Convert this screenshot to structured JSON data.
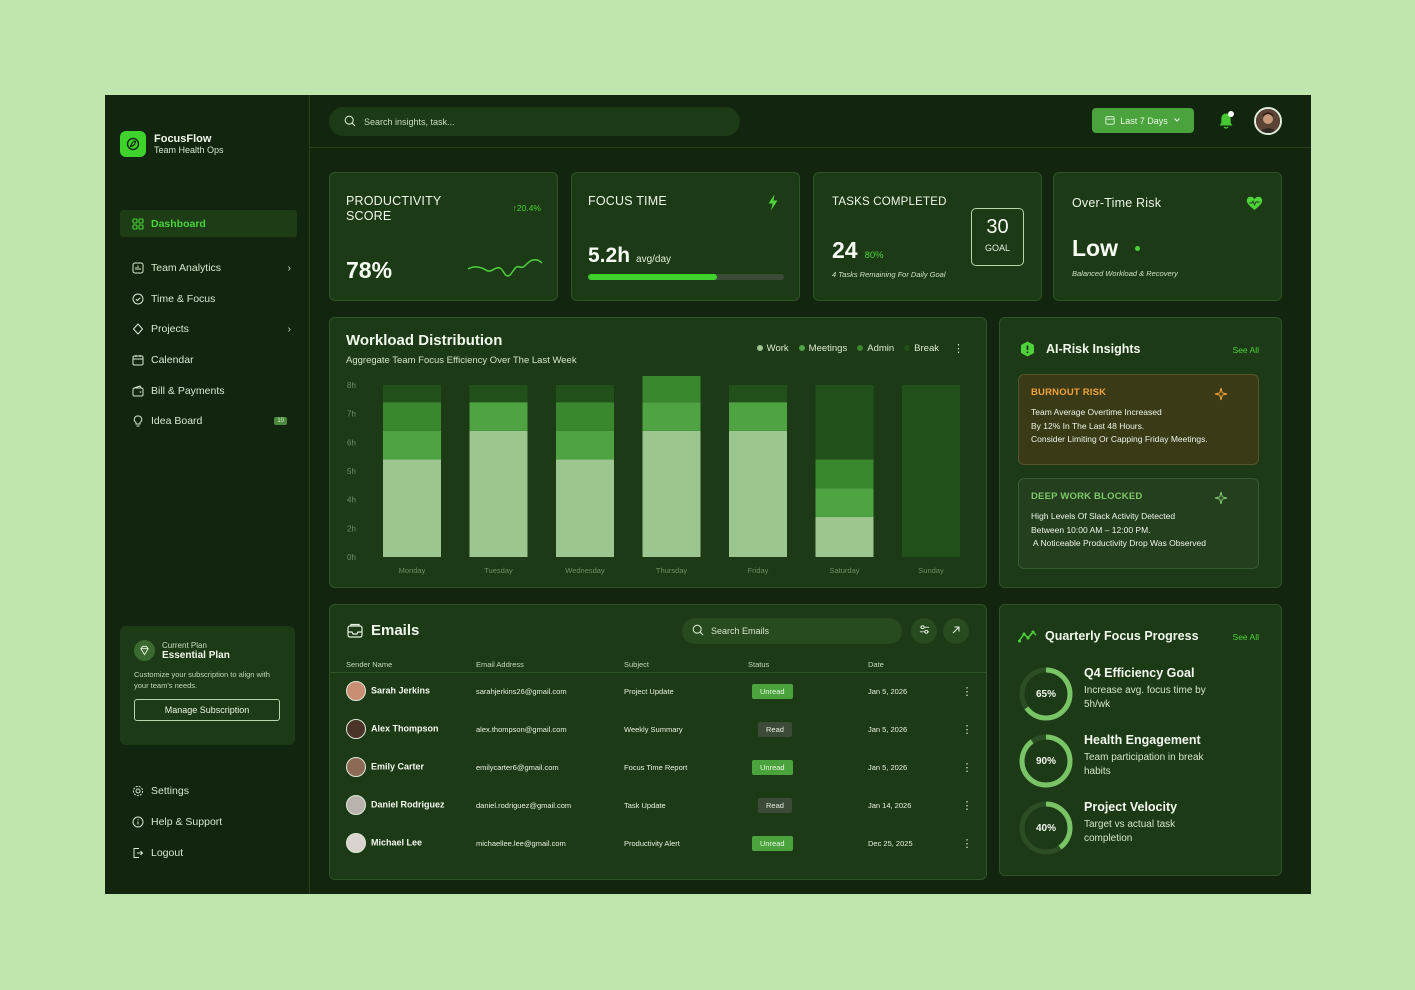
{
  "brand": {
    "name": "FocusFlow",
    "subtitle": "Team Health Ops"
  },
  "nav": [
    {
      "label": "Dashboard",
      "icon": "dashboard-icon",
      "active": true
    },
    {
      "label": "Team Analytics",
      "icon": "analytics-icon",
      "chevron": true
    },
    {
      "label": "Time & Focus",
      "icon": "clock-check-icon"
    },
    {
      "label": "Projects",
      "icon": "projects-icon",
      "chevron": true
    },
    {
      "label": "Calendar",
      "icon": "calendar-icon"
    },
    {
      "label": "Bill & Payments",
      "icon": "wallet-icon"
    },
    {
      "label": "Idea Board",
      "icon": "lightbulb-icon",
      "badge": "10"
    }
  ],
  "plan": {
    "label": "Current Plan",
    "name": "Essential Plan",
    "description": "Customize your subscription to align with your team's needs.",
    "button": "Manage Subscription"
  },
  "bottom_nav": [
    {
      "label": "Settings",
      "icon": "gear-icon"
    },
    {
      "label": "Help & Support",
      "icon": "info-icon"
    },
    {
      "label": "Logout",
      "icon": "logout-icon"
    }
  ],
  "search": {
    "placeholder": "Search insights, task..."
  },
  "date_range": "Last 7 Days",
  "kpis": {
    "productivity": {
      "title": "PRODUCTIVITY SCORE",
      "value": "78%",
      "change": "20.4%"
    },
    "focus": {
      "title": "FOCUS TIME",
      "value": "5.2h",
      "unit": "avg/day",
      "progress": 0.66
    },
    "tasks": {
      "title": "TASKS COMPLETED",
      "value": "24",
      "percent": "80%",
      "note": "4 Tasks Remaining For Daily Goal",
      "goal_value": "30",
      "goal_label": "GOAL"
    },
    "risk": {
      "title": "Over-Time Risk",
      "value": "Low",
      "note": "Balanced Workload & Recovery"
    }
  },
  "workload": {
    "title": "Workload Distribution",
    "subtitle": "Aggregate Team Focus Efficiency Over The Last Week",
    "legend": [
      {
        "name": "Work",
        "color": "#9cc590"
      },
      {
        "name": "Meetings",
        "color": "#4fa342"
      },
      {
        "name": "Admin",
        "color": "#3b8730"
      },
      {
        "name": "Break",
        "color": "#21501a"
      }
    ]
  },
  "chart_data": {
    "type": "bar",
    "stacked": true,
    "categories": [
      "Monday",
      "Tuesday",
      "Wednesday",
      "Thursday",
      "Friday",
      "Saturday",
      "Sunday"
    ],
    "y_ticks": [
      "0h",
      "2h",
      "4h",
      "5h",
      "6h",
      "7h",
      "8h"
    ],
    "series": [
      {
        "name": "Work",
        "color": "#9cc590",
        "values": [
          3.4,
          4.4,
          3.4,
          4.4,
          4.4,
          1.4,
          0
        ]
      },
      {
        "name": "Meetings",
        "color": "#4fa342",
        "values": [
          1.0,
          1.0,
          1.0,
          1.0,
          1.0,
          1.0,
          0
        ]
      },
      {
        "name": "Admin",
        "color": "#3b8730",
        "values": [
          1.0,
          0.0,
          1.0,
          1.0,
          0.0,
          1.0,
          0
        ]
      },
      {
        "name": "Break",
        "color": "#21501a",
        "values": [
          0.6,
          0.6,
          0.6,
          0.6,
          0.6,
          2.6,
          6.0
        ]
      }
    ]
  },
  "insights": {
    "title": "AI-Risk Insights",
    "see_all": "See All",
    "items": [
      {
        "title": "BURNOUT RISK",
        "text": [
          "Team Average Overtime Increased",
          "By 12% In The Last 48 Hours.",
          "Consider Limiting Or Capping Friday Meetings."
        ]
      },
      {
        "title": "DEEP WORK BLOCKED",
        "text": [
          "High Levels Of Slack Activity Detected",
          "Between 10:00 AM – 12:00 PM.",
          " A Noticeable Productivity Drop Was Observed"
        ]
      }
    ]
  },
  "emails": {
    "title": "Emails",
    "search_placeholder": "Search Emails",
    "columns": [
      "Sender Name",
      "Email Address",
      "Subject",
      "Status",
      "Date"
    ],
    "rows": [
      {
        "name": "Sarah Jerkins",
        "email": "sarahjerkins26@gmail.com",
        "subject": "Project Update",
        "status": "Unread",
        "date": "Jan 5, 2026"
      },
      {
        "name": "Alex Thompson",
        "email": "alex.thompson@gmail.com",
        "subject": "Weekly Summary",
        "status": "Read",
        "date": "Jan 5, 2026"
      },
      {
        "name": "Emily Carter",
        "email": "emilycarter6@gmail.com",
        "subject": "Focus Time Report",
        "status": "Unread",
        "date": "Jan 5, 2026"
      },
      {
        "name": "Daniel Rodriguez",
        "email": "daniel.rodriguez@gmail.com",
        "subject": "Task Update",
        "status": "Read",
        "date": "Jan 14, 2026"
      },
      {
        "name": "Michael Lee",
        "email": "michaellee.lee@gmail.com",
        "subject": "Productivity Alert",
        "status": "Unread",
        "date": "Dec 25, 2025"
      }
    ]
  },
  "quarterly": {
    "title": "Quarterly Focus Progress",
    "see_all": "See All",
    "goals": [
      {
        "percent": 65,
        "label": "65%",
        "title": "Q4 Efficiency Goal",
        "desc": [
          "Increase avg. focus time by",
          "5h/wk"
        ]
      },
      {
        "percent": 90,
        "label": "90%",
        "title": "Health Engagement",
        "desc": [
          "Team participation in break",
          "habits"
        ]
      },
      {
        "percent": 40,
        "label": "40%",
        "title": "Project Velocity",
        "desc": [
          "Target vs actual task",
          "completion"
        ]
      }
    ]
  }
}
